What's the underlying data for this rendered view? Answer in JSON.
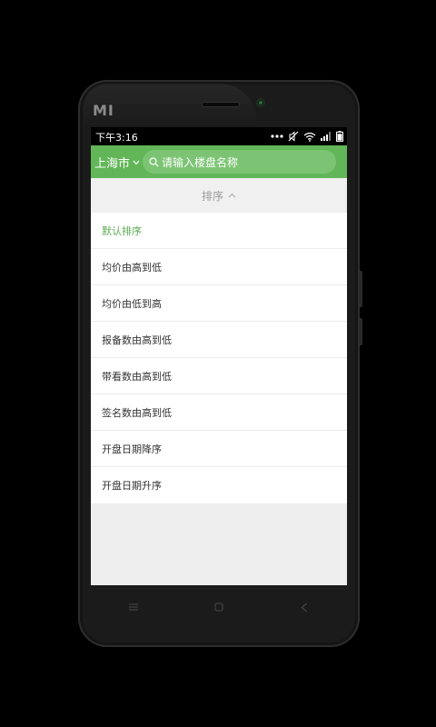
{
  "device": {
    "brand_logo": "MI",
    "frame_color": "#1b1b1b"
  },
  "statusbar": {
    "time": "下午3:16",
    "icons": [
      "notification-dots-icon",
      "mute-icon",
      "wifi-icon",
      "signal-icon",
      "battery-icon"
    ]
  },
  "header": {
    "city_label": "上海市",
    "search_placeholder": "请输入楼盘名称",
    "accent_color": "#62b658"
  },
  "sort": {
    "header_label": "排序",
    "options": [
      {
        "label": "默认排序",
        "selected": true
      },
      {
        "label": "均价由高到低",
        "selected": false
      },
      {
        "label": "均价由低到高",
        "selected": false
      },
      {
        "label": "报备数由高到低",
        "selected": false
      },
      {
        "label": "带看数由高到低",
        "selected": false
      },
      {
        "label": "签名数由高到低",
        "selected": false
      },
      {
        "label": "开盘日期降序",
        "selected": false
      },
      {
        "label": "开盘日期升序",
        "selected": false
      }
    ],
    "selected_color": "#5cad52"
  },
  "navbar": {
    "keys": [
      "menu-key-icon",
      "home-key-icon",
      "back-key-icon"
    ]
  }
}
